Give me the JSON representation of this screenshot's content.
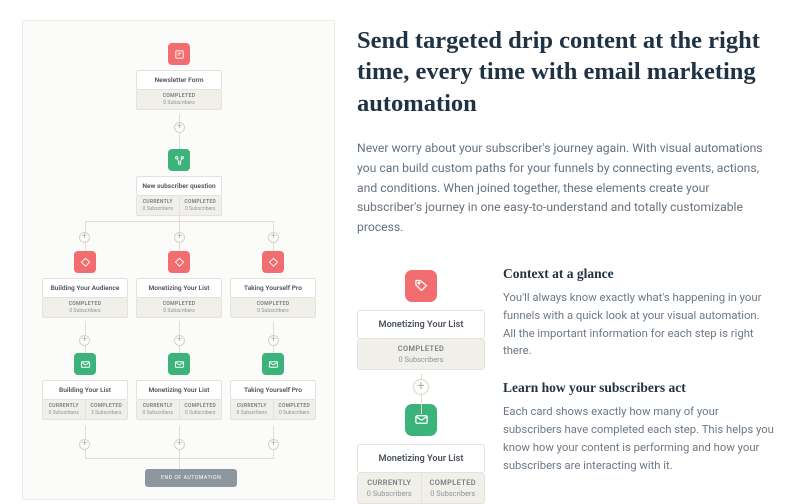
{
  "headline": "Send targeted drip content at the right time, every time with email marketing automation",
  "intro": "Never worry about your subscriber's journey again. With visual automations you can build custom paths for your funnels by connecting events, actions, and conditions. When joined together, these elements create your subscriber's journey in one easy-to-understand and totally customizable process.",
  "diagram": {
    "newsletter": {
      "title": "Newsletter Form",
      "completed_label": "COMPLETED",
      "completed_value": "0 Subscribers"
    },
    "question": {
      "title": "New subscriber question",
      "currently_label": "CURRENTLY",
      "currently_value": "0 Subscribers",
      "completed_label": "COMPLETED",
      "completed_value": "0 Subscribers"
    },
    "row1": [
      {
        "title": "Building Your Audience",
        "completed_label": "COMPLETED",
        "completed_value": "0 Subscribers"
      },
      {
        "title": "Monetizing Your List",
        "completed_label": "COMPLETED",
        "completed_value": "0 Subscribers"
      },
      {
        "title": "Taking Yourself Pro",
        "completed_label": "COMPLETED",
        "completed_value": "0 Subscribers"
      }
    ],
    "row2": [
      {
        "title": "Building Your List",
        "currently_label": "CURRENTLY",
        "currently_value": "0 Subscribers",
        "completed_label": "COMPLETED",
        "completed_value": "3 Subscribers"
      },
      {
        "title": "Monetizing Your List",
        "currently_label": "CURRENTLY",
        "currently_value": "0 Subscribers",
        "completed_label": "COMPLETED",
        "completed_value": "0 Subscribers"
      },
      {
        "title": "Taking Yourself Pro",
        "currently_label": "CURRENTLY",
        "currently_value": "0 Subscribers",
        "completed_label": "COMPLETED",
        "completed_value": "0 Subscribers"
      }
    ],
    "end_label": "END OF AUTOMATION"
  },
  "detail": {
    "card1": {
      "title": "Monetizing Your List",
      "completed_label": "COMPLETED",
      "completed_value": "0 Subscribers"
    },
    "card2": {
      "title": "Monetizing Your List",
      "currently_label": "CURRENTLY",
      "currently_value": "0 Subscribers",
      "completed_label": "COMPLETED",
      "completed_value": "0 Subscribers"
    }
  },
  "sections": [
    {
      "heading": "Context at a glance",
      "body": "You'll always know exactly what's happening in your funnels with a quick look at your visual automation. All the important information for each step is right there."
    },
    {
      "heading": "Learn how your subscribers act",
      "body": "Each card shows exactly how many of your subscribers have completed each step. This helps you know how your content is performing and how your subscribers are interacting with it."
    }
  ]
}
